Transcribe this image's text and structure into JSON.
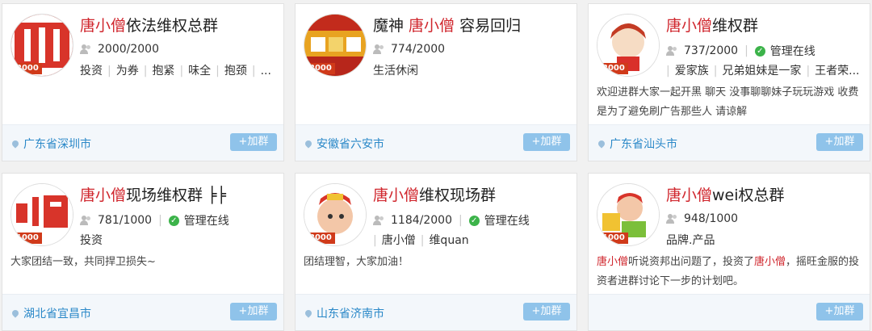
{
  "cards": [
    {
      "badge": "2000",
      "title_hl": "唐小僧",
      "title_rest": "依法维权总群",
      "title_pre": "",
      "members": "2000/2000",
      "managed": "",
      "tags": [
        "投资",
        "为券",
        "抱紧",
        "味全",
        "抱颈",
        "..."
      ],
      "desc": "",
      "location": "广东省深圳市",
      "join": "+加群"
    },
    {
      "badge": "2000",
      "title_pre": "魔神 ",
      "title_hl": "唐小僧",
      "title_rest": " 容易回归",
      "members": "774/2000",
      "managed": "",
      "tags": [
        "生活休闲"
      ],
      "desc": "",
      "location": "安徽省六安市",
      "join": "+加群"
    },
    {
      "badge": "2000",
      "title_pre": "",
      "title_hl": "唐小僧",
      "title_rest": "维权群",
      "members": "737/2000",
      "managed": "管理在线",
      "tags": [
        "",
        "爱家族",
        "兄弟姐妹是一家",
        "王者荣..."
      ],
      "desc": "欢迎进群大家一起开黑 聊天 没事聊聊妹子玩玩游戏 收费是为了避免刷广告那些人 请谅解",
      "location": "广东省汕头市",
      "join": "+加群"
    },
    {
      "badge": "1000",
      "title_pre": "",
      "title_hl": "唐小僧",
      "title_rest": "现场维权群 ╞╞",
      "members": "781/1000",
      "managed": "管理在线",
      "tags": [
        "投资"
      ],
      "desc": "大家团结一致，共同捍卫损失~",
      "location": "湖北省宜昌市",
      "join": "+加群"
    },
    {
      "badge": "2000",
      "title_pre": "",
      "title_hl": "唐小僧",
      "title_rest": "维权现场群",
      "members": "1184/2000",
      "managed": "管理在线",
      "tags": [
        "",
        "唐小僧",
        "维quan"
      ],
      "desc": "团结理智，大家加油！",
      "location": "山东省济南市",
      "join": "+加群"
    },
    {
      "badge": "1000",
      "title_pre": "",
      "title_hl": "唐小僧",
      "title_rest": "wei权总群",
      "members": "948/1000",
      "managed": "",
      "tags": [
        "品牌.产品"
      ],
      "desc_parts": [
        "唐小僧",
        "听说资邦出问题了，投资了",
        "唐小僧",
        "，摇旺金服的投资者进群讨论下一步的计划吧。"
      ],
      "desc": "",
      "location": "",
      "join": "+加群"
    }
  ],
  "colors": {
    "accent": "#d0272e",
    "link": "#2a88c8",
    "join_bg": "#8fc3ea",
    "ok_green": "#3cb34a"
  }
}
